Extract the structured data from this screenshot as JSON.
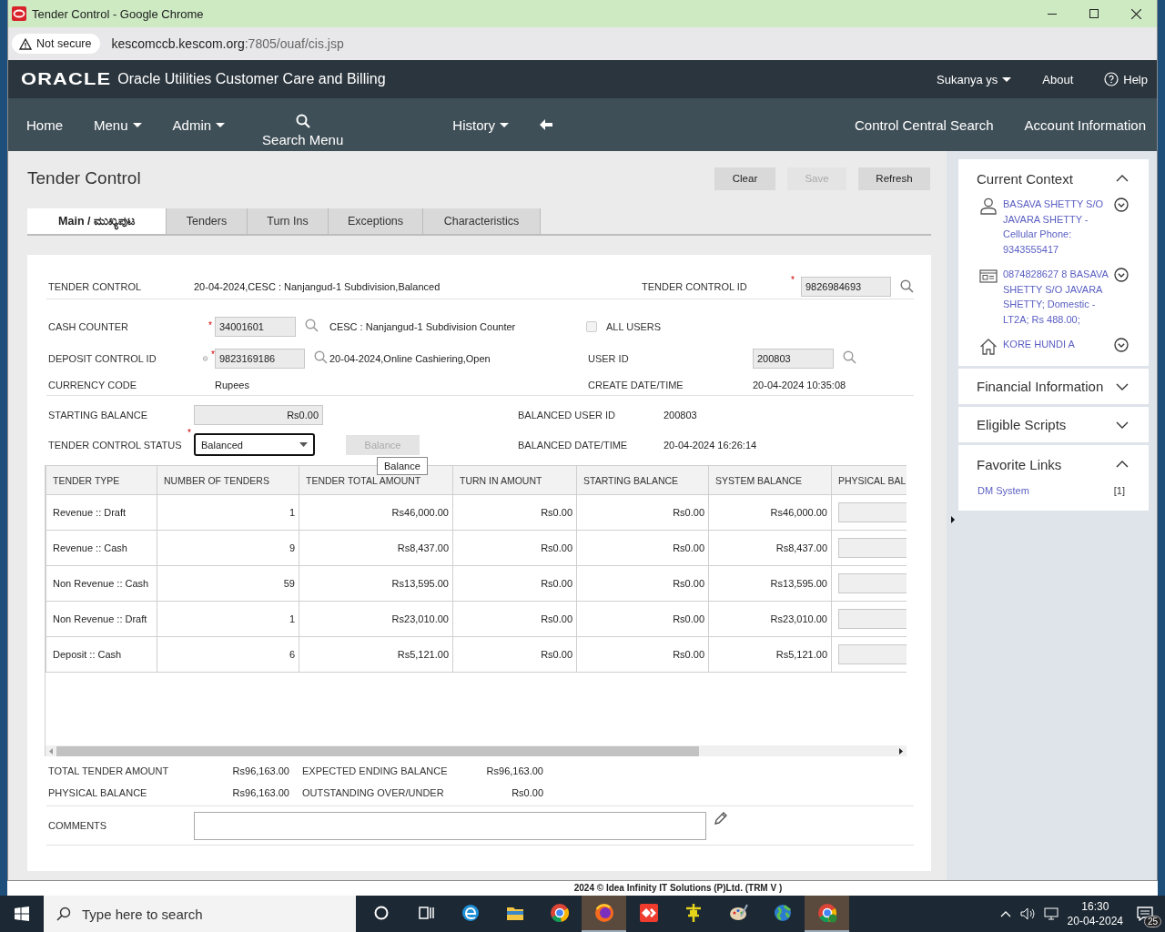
{
  "browser": {
    "title": "Tender Control - Google Chrome",
    "security": "Not secure",
    "url_host": "kescomccb.kescom.org",
    "url_path": ":7805/ouaf/cis.jsp"
  },
  "app_header": {
    "logo": "ORACLE",
    "product": "Oracle Utilities Customer Care and Billing",
    "user": "Sukanya ys",
    "about": "About",
    "help": "Help"
  },
  "nav": {
    "left": [
      {
        "label": "Home",
        "dropdown": false
      },
      {
        "label": "Menu",
        "dropdown": true
      },
      {
        "label": "Admin",
        "dropdown": true
      }
    ],
    "search": "Search Menu",
    "history": "History",
    "right": [
      "Control Central Search",
      "Account Information"
    ]
  },
  "page": {
    "title": "Tender Control",
    "actions": [
      {
        "label": "Clear",
        "disabled": false
      },
      {
        "label": "Save",
        "disabled": true
      },
      {
        "label": "Refresh",
        "disabled": false
      }
    ],
    "tabs": [
      {
        "label": "Main / ಮುಖ್ಯಪುಟ",
        "selected": true
      },
      {
        "label": "Tenders",
        "selected": false
      },
      {
        "label": "Turn Ins",
        "selected": false
      },
      {
        "label": "Exceptions",
        "selected": false
      },
      {
        "label": "Characteristics",
        "selected": false
      }
    ]
  },
  "form": {
    "tender_control": {
      "label": "TENDER CONTROL",
      "value": "20-04-2024,CESC : Nanjangud-1 Subdivision,Balanced"
    },
    "tender_control_id": {
      "label": "TENDER CONTROL ID",
      "value": "9826984693",
      "required_mark": "*"
    },
    "cash_counter": {
      "label": "CASH COUNTER",
      "value": "34001601",
      "description": "CESC : Nanjangud-1 Subdivision Counter",
      "required_mark": "*"
    },
    "all_users": {
      "label": "ALL USERS",
      "checked": false
    },
    "deposit_control_id": {
      "label": "DEPOSIT CONTROL ID",
      "value": "9823169186",
      "description": "20-04-2024,Online Cashiering,Open",
      "required_mark": "*"
    },
    "user_id": {
      "label": "USER ID",
      "value": "200803"
    },
    "currency_code": {
      "label": "CURRENCY CODE",
      "value": "Rupees"
    },
    "create_datetime": {
      "label": "CREATE DATE/TIME",
      "value": "20-04-2024 10:35:08"
    },
    "starting_balance": {
      "label": "STARTING BALANCE",
      "value": "Rs0.00"
    },
    "balanced_user_id": {
      "label": "BALANCED USER ID",
      "value": "200803"
    },
    "tender_control_status": {
      "label": "TENDER CONTROL STATUS",
      "value": "Balanced",
      "required_mark": "*"
    },
    "balance_button": {
      "label": "Balance",
      "disabled": true
    },
    "balanced_datetime": {
      "label": "BALANCED DATE/TIME",
      "value": "20-04-2024 16:26:14"
    }
  },
  "tooltip": "Balance",
  "table": {
    "columns": [
      "TENDER TYPE",
      "NUMBER OF TENDERS",
      "TENDER TOTAL AMOUNT",
      "TURN IN AMOUNT",
      "STARTING BALANCE",
      "SYSTEM BALANCE",
      "PHYSICAL BAL"
    ],
    "rows": [
      [
        "Revenue :: Draft",
        "1",
        "Rs46,000.00",
        "Rs0.00",
        "Rs0.00",
        "Rs46,000.00"
      ],
      [
        "Revenue :: Cash",
        "9",
        "Rs8,437.00",
        "Rs0.00",
        "Rs0.00",
        "Rs8,437.00"
      ],
      [
        "Non Revenue :: Cash",
        "59",
        "Rs13,595.00",
        "Rs0.00",
        "Rs0.00",
        "Rs13,595.00"
      ],
      [
        "Non Revenue :: Draft",
        "1",
        "Rs23,010.00",
        "Rs0.00",
        "Rs0.00",
        "Rs23,010.00"
      ],
      [
        "Deposit :: Cash",
        "6",
        "Rs5,121.00",
        "Rs0.00",
        "Rs0.00",
        "Rs5,121.00"
      ]
    ]
  },
  "totals": [
    {
      "label": "TOTAL TENDER AMOUNT",
      "value": "Rs96,163.00"
    },
    {
      "label": "EXPECTED ENDING BALANCE",
      "value": "Rs96,163.00"
    },
    {
      "label": "PHYSICAL BALANCE",
      "value": "Rs96,163.00"
    },
    {
      "label": "OUTSTANDING OVER/UNDER",
      "value": "Rs0.00"
    }
  ],
  "comments": {
    "label": "COMMENTS"
  },
  "sidebar": {
    "sections": [
      {
        "title": "Current Context",
        "expanded": true,
        "items": [
          {
            "kind": "person",
            "text": "BASAVA SHETTY S/O JAVARA SHETTY - Cellular Phone: 9343555417"
          },
          {
            "kind": "account",
            "text": "0874828627 8 BASAVA SHETTY S/O JAVARA SHETTY; Domestic - LT2A; Rs 488.00;"
          },
          {
            "kind": "premise",
            "text": "KORE HUNDI A"
          }
        ]
      },
      {
        "title": "Financial Information",
        "expanded": false
      },
      {
        "title": "Eligible Scripts",
        "expanded": false
      },
      {
        "title": "Favorite Links",
        "expanded": true,
        "links": [
          {
            "label": "DM System",
            "count": "[1]"
          }
        ]
      }
    ]
  },
  "credit": "2024 © Idea Infinity IT Solutions (P)Ltd. (TRM V )",
  "taskbar": {
    "search_placeholder": "Type here to search",
    "time": "16:30",
    "date": "20-04-2024",
    "notifications": "25",
    "apps": [
      {
        "kind": "cortana",
        "active": false
      },
      {
        "kind": "taskview",
        "active": false
      },
      {
        "kind": "edge",
        "active": false
      },
      {
        "kind": "folder",
        "active": false
      },
      {
        "kind": "chrome",
        "active": false
      },
      {
        "kind": "firefox",
        "active": true
      },
      {
        "kind": "anydesk",
        "active": false
      },
      {
        "kind": "vpn",
        "active": false
      },
      {
        "kind": "paint",
        "active": false
      },
      {
        "kind": "globe",
        "active": false
      },
      {
        "kind": "chromeuser",
        "active": true
      }
    ]
  }
}
